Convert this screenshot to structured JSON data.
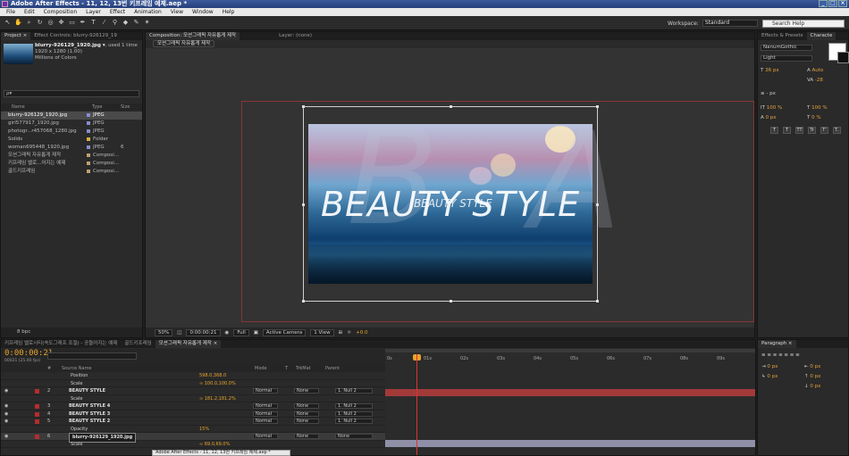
{
  "window": {
    "title": "Adobe After Effects - 11, 12, 13번 키프레임 예제.aep *"
  },
  "menu": [
    "File",
    "Edit",
    "Composition",
    "Layer",
    "Effect",
    "Animation",
    "View",
    "Window",
    "Help"
  ],
  "toolbar": {
    "workspace_label": "Workspace:",
    "workspace_value": "Standard",
    "search_placeholder": "Search Help"
  },
  "project": {
    "tabs": [
      "Project ×",
      "Effect Controls: blurry-926129_19"
    ],
    "selected_file": "blurry-926129_1920.jpg ▾",
    "used": ", used 1 time",
    "dims": "1920 x 1280 (1.00)",
    "colors": "Millions of Colors",
    "search": "ρ▾",
    "columns": [
      "Name",
      "Type",
      "Size"
    ],
    "items": [
      {
        "name": "blurry-926129_1920.jpg",
        "type": "JPEG",
        "size": "",
        "color": "#8a8ad0",
        "sel": true
      },
      {
        "name": "girl577917_1920.jpg",
        "type": "JPEG",
        "size": "",
        "color": "#8a8ad0"
      },
      {
        "name": "photogr...r457068_1280.jpg",
        "type": "JPEG",
        "size": "",
        "color": "#8a8ad0"
      },
      {
        "name": "Solids",
        "type": "Folder",
        "size": "",
        "color": "#d8b040"
      },
      {
        "name": "woman695448_1920.jpg",
        "type": "JPEG",
        "size": "6",
        "color": "#8a8ad0"
      },
      {
        "name": "모션그래픽 자유롭게 제작",
        "type": "Composi...",
        "size": "",
        "color": "#c0a070"
      },
      {
        "name": "키프레임 벨로...어지는 예제",
        "type": "Composi...",
        "size": "",
        "color": "#c0a070"
      },
      {
        "name": "골드키프레임",
        "type": "Composi...",
        "size": "",
        "color": "#c0a070"
      }
    ],
    "bpc": "8 bpc"
  },
  "comp": {
    "tabs": [
      "Composition: 모션그래픽 자유롭게 제작",
      "Layer: (none)"
    ],
    "breadcrumb": "모션그래픽 자유롭게 제작",
    "big_title": "BEAUTY STYLE",
    "small_title": "BEAUTY STYLE",
    "ghost_b": "B",
    "ghost_a": "A",
    "footer": {
      "zoom": "50%",
      "time": "0:00:00:21",
      "res": "Full",
      "camera": "Active Camera",
      "view": "1 View",
      "exposure": "+0.0"
    }
  },
  "right_panel": {
    "tabs": [
      "Effects & Presets",
      "Characte"
    ],
    "font": "NanumGothic",
    "style": "Light",
    "size": "36 px",
    "leading": "Auto",
    "tracking": "-28",
    "unit": "- px",
    "vscale": "100 %",
    "hscale": "100 %",
    "baseline": "0 px",
    "tsume": "0 %",
    "format_buttons": [
      "T",
      "T",
      "TT",
      "Tr",
      "T'",
      "T,"
    ]
  },
  "timeline": {
    "tabs": [
      "키프레임 벨로시티(속도그래프 조절) - 공들어지는 예제",
      "골드키프레임",
      "모션그래픽 자유롭게 제작 ×"
    ],
    "timecode": "0:00:00:21",
    "fps": "00021 (25.00 fps)",
    "columns": [
      "#",
      "Source Name",
      "Mode",
      "T",
      "TrkMat",
      "Parent"
    ],
    "ruler": [
      "0s",
      "01s",
      "02s",
      "03s",
      "04s",
      "05s",
      "06s",
      "07s",
      "08s",
      "09s"
    ],
    "rows": [
      {
        "kind": "prop",
        "name": "Position",
        "val": "598.0,368.0"
      },
      {
        "kind": "prop",
        "name": "Scale",
        "val": "∞ 100.0,100.0%"
      },
      {
        "kind": "layer",
        "num": "2",
        "name": "BEAUTY STYLE",
        "mode": "Normal",
        "trk": "None",
        "parent": "1. Null 2",
        "color": "#a33a3a"
      },
      {
        "kind": "prop",
        "name": "Scale",
        "val": "∞ 181.2,181.2%"
      },
      {
        "kind": "layer",
        "num": "3",
        "name": "BEAUTY STYLE 4",
        "mode": "Normal",
        "trk": "None",
        "parent": "1. Null 2",
        "color": "#2b2b2b"
      },
      {
        "kind": "layer",
        "num": "4",
        "name": "BEAUTY STYLE 3",
        "mode": "Normal",
        "trk": "None",
        "parent": "1. Null 2",
        "color": "#2b2b2b"
      },
      {
        "kind": "layer",
        "num": "5",
        "name": "BEAUTY STYLE 2",
        "mode": "Normal",
        "trk": "None",
        "parent": "1. Null 2",
        "color": "#2b2b2b"
      },
      {
        "kind": "prop",
        "name": "Opacity",
        "val": "15%"
      },
      {
        "kind": "layer",
        "num": "6",
        "name": "blurry-926129_1920.jpg",
        "mode": "Normal",
        "trk": "None",
        "parent": "None",
        "color": "#8f8fa8",
        "sel": true
      },
      {
        "kind": "prop",
        "name": "Scale",
        "val": "∞ 69.0,69.0%"
      }
    ]
  },
  "paragraph": {
    "tab": "Paragraph ×",
    "v1": "0 px",
    "v2": "0 px",
    "v3": "0 px",
    "v4": "0 px",
    "v5": "0 px"
  },
  "taskbar": "Adobe After Effects - 11, 12, 13번 키프레임 예제.aep *"
}
